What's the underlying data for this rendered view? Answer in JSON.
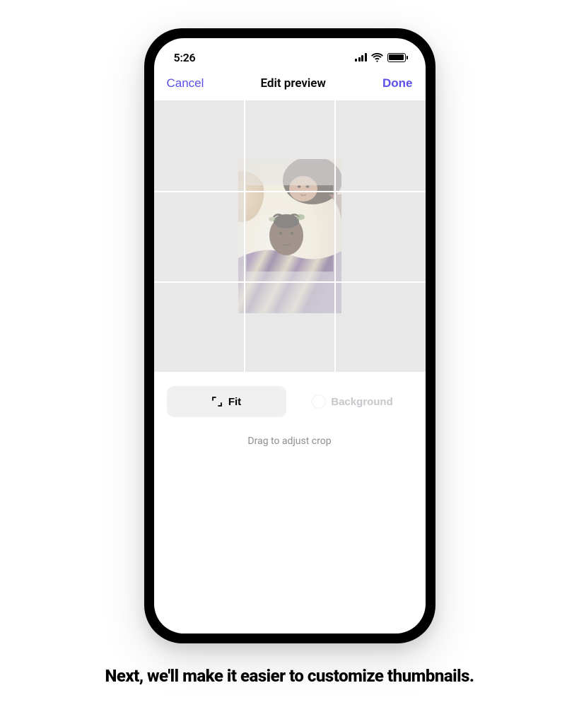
{
  "status_bar": {
    "time": "5:26"
  },
  "nav": {
    "cancel_label": "Cancel",
    "title": "Edit preview",
    "done_label": "Done"
  },
  "controls": {
    "fit_label": "Fit",
    "background_label": "Background"
  },
  "hint": "Drag to adjust crop",
  "caption": "Next, we'll  make it easier to customize thumbnails.",
  "colors": {
    "accent": "#5b4fe8",
    "crop_bg": "#e8e8e8",
    "hint_text": "#8e8e93",
    "disabled_text": "#c7c7cc"
  }
}
